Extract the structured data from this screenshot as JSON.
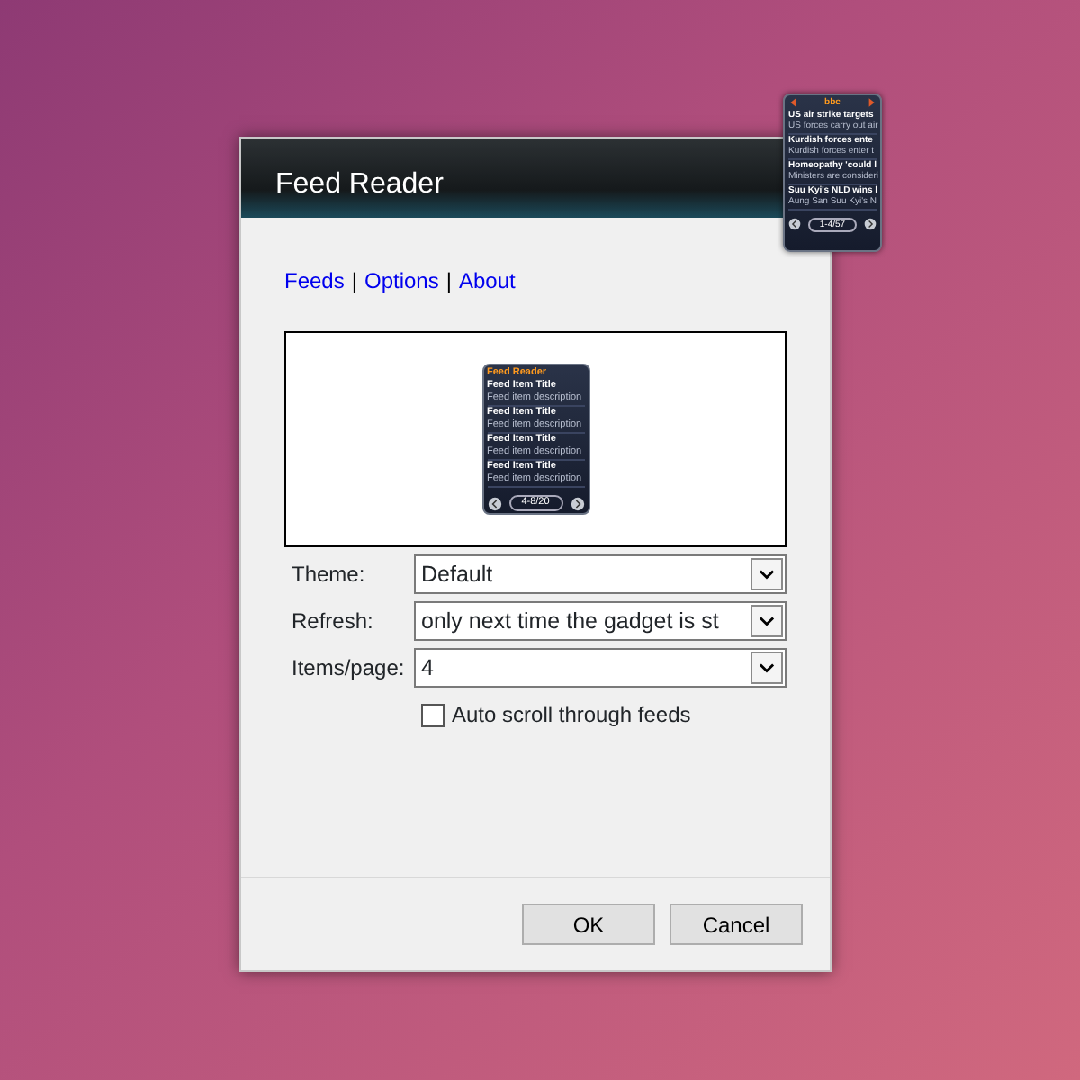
{
  "desktop_gadget": {
    "title": "bbc",
    "items": [
      {
        "title": "US air strike targets",
        "description": "US forces carry out air"
      },
      {
        "title": "Kurdish forces ente",
        "description": "Kurdish forces enter t"
      },
      {
        "title": "Homeopathy 'could l",
        "description": "Ministers are consideri"
      },
      {
        "title": "Suu Kyi's NLD wins l",
        "description": "Aung San Suu Kyi's N"
      }
    ],
    "pager": "1-4/57"
  },
  "dialog": {
    "title": "Feed Reader",
    "separator": "|",
    "nav_links": [
      "Feeds",
      "Options",
      "About"
    ],
    "preview": {
      "title": "Feed Reader",
      "items": [
        {
          "title": "Feed Item Title",
          "description": "Feed item description"
        },
        {
          "title": "Feed Item Title",
          "description": "Feed item description"
        },
        {
          "title": "Feed Item Title",
          "description": "Feed item description"
        },
        {
          "title": "Feed Item Title",
          "description": "Feed item description"
        }
      ],
      "pager": "4-8/20"
    },
    "fields": [
      {
        "label": "Theme:",
        "value": "Default"
      },
      {
        "label": "Refresh:",
        "value": "only next time the gadget is st"
      },
      {
        "label": "Items/page:",
        "value": "4"
      }
    ],
    "auto_scroll": {
      "label": "Auto scroll through feeds",
      "checked": false
    },
    "buttons": [
      "OK",
      "Cancel"
    ]
  }
}
